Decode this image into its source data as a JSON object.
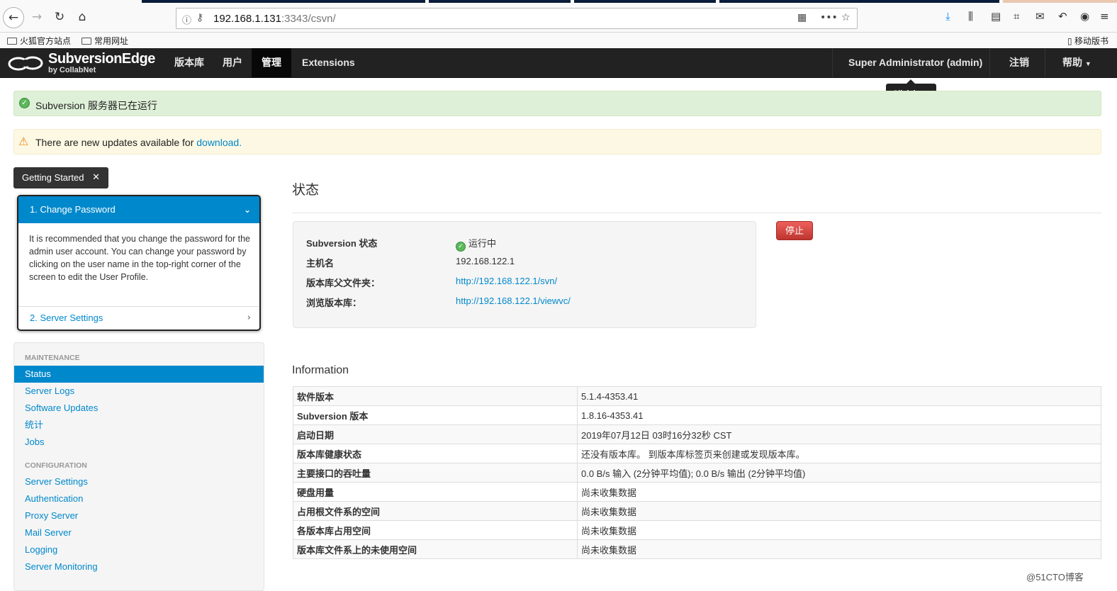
{
  "browser": {
    "url_host": "192.168.1.131",
    "url_rest": ":3343/csvn/",
    "bookmarks": [
      "火狐官方站点",
      "常用网址"
    ],
    "mobile_bookmarks": "移动版书"
  },
  "header": {
    "logo_title": "SubversionEdge",
    "logo_sub": "by CollabNet",
    "nav": [
      "版本库",
      "用户",
      "管理",
      "Extensions"
    ],
    "user": "Super Administrator (admin)",
    "logout": "注销",
    "help": "帮助",
    "tooltip": "Click here"
  },
  "alerts": {
    "success": "Subversion 服务器已在运行",
    "warning_text": "There are new updates available for ",
    "warning_link": "download."
  },
  "getting_started": {
    "button": "Getting Started",
    "step1": "1. Change Password",
    "step1_desc": "It is recommended that you change the password for the admin user account. You can change your password by clicking on the user name in the top-right corner of the screen to edit the User Profile.",
    "step2": "2. Server Settings"
  },
  "sidebar": {
    "maintenance_header": "MAINTENANCE",
    "maintenance": [
      "Status",
      "Server Logs",
      "Software Updates",
      "统计",
      "Jobs"
    ],
    "configuration_header": "CONFIGURATION",
    "configuration": [
      "Server Settings",
      "Authentication",
      "Proxy Server",
      "Mail Server",
      "Logging",
      "Server Monitoring"
    ]
  },
  "main": {
    "title": "状态",
    "stop_button": "停止",
    "status": [
      {
        "label": "Subversion 状态",
        "value": "运行中"
      },
      {
        "label": "主机名",
        "value": "192.168.122.1"
      },
      {
        "label": "版本库父文件夹：",
        "value": "http://192.168.122.1/svn/"
      },
      {
        "label": "浏览版本库：",
        "value": "http://192.168.122.1/viewvc/"
      }
    ],
    "info_title": "Information",
    "info": [
      {
        "k": "软件版本",
        "v": "5.1.4-4353.41"
      },
      {
        "k": "Subversion 版本",
        "v": "1.8.16-4353.41"
      },
      {
        "k": "启动日期",
        "v": "2019年07月12日 03时16分32秒 CST"
      },
      {
        "k": "版本库健康状态",
        "v": "还没有版本库。 到版本库标签页来创建或发现版本库。"
      },
      {
        "k": "主要接口的吞吐量",
        "v": "0.0 B/s 输入 (2分钟平均值); 0.0 B/s 输出 (2分钟平均值)"
      },
      {
        "k": "硬盘用量",
        "v": "尚未收集数据"
      },
      {
        "k": "占用根文件系的空间",
        "v": "尚未收集数据"
      },
      {
        "k": "各版本库占用空间",
        "v": "尚未收集数据"
      },
      {
        "k": "版本库文件系上的未使用空间",
        "v": "尚未收集数据"
      }
    ]
  },
  "watermark": "@51CTO博客",
  "colors": {
    "accent": "#0088cc",
    "header_bg": "#222222",
    "success_bg": "#dff0d8",
    "warning_bg": "#fcf8e3",
    "danger": "#d9534f"
  }
}
